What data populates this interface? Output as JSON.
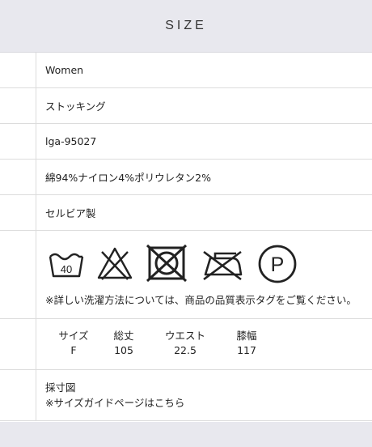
{
  "header": {
    "title": "SIZE"
  },
  "rows": {
    "gender": "Women",
    "category": "ストッキング",
    "product_code": "lga-95027",
    "material": "綿94%ナイロン4%ポリウレタン2%",
    "origin": "セルビア製"
  },
  "care": {
    "icons": [
      "wash-40-icon",
      "no-bleach-icon",
      "no-tumble-dry-icon",
      "no-iron-icon",
      "dry-clean-p-icon"
    ],
    "wash_temp": "40",
    "dry_clean_letter": "P",
    "note": "※詳しい洗濯方法については、商品の品質表示タグをご覧ください。"
  },
  "size_table": {
    "headers": [
      "サイズ",
      "総丈",
      "ウエスト",
      "膝幅"
    ],
    "values": [
      "F",
      "105",
      "22.5",
      "117"
    ]
  },
  "size_guide": {
    "line1": "採寸図",
    "line2": "※サイズガイドページはこちら"
  },
  "colors": {
    "header_bg": "#e8e8ee",
    "border": "#dcdcdc",
    "text": "#222222"
  }
}
